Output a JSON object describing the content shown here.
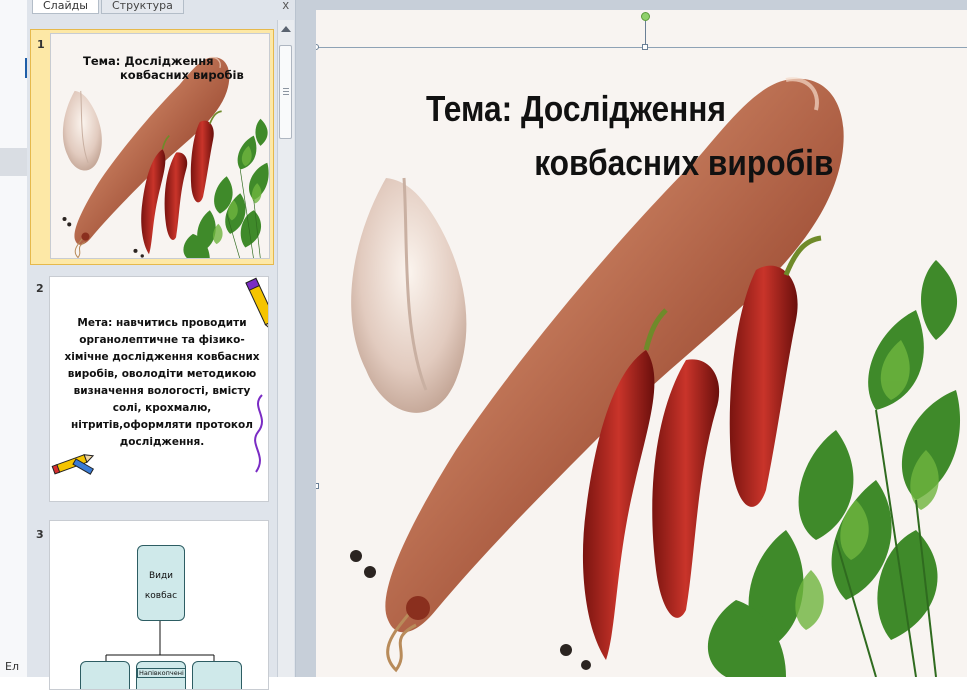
{
  "status_bar": {
    "text": "Ел"
  },
  "panel": {
    "tabs": [
      {
        "label": "Слайды"
      },
      {
        "label": "Структура"
      }
    ],
    "close_label": "x"
  },
  "slides": [
    {
      "number": "1",
      "title_line1": "Тема:  Дослідження",
      "title_line2": "ковбасних виробів"
    },
    {
      "number": "2",
      "goal_text": "Мета: навчитись проводити органолептичне та фізико-хімічне дослідження ковбасних виробів, оволодіти методикою визначення вологості, вмісту солі, крохмалю, нітритів,оформляти протокол дослідження."
    },
    {
      "number": "3",
      "box_main": "Види ковбас",
      "box_mid": "Напівкопчені"
    }
  ],
  "editor": {
    "title_line1": "Тема:  Дослідження",
    "title_line2": "ковбасних виробів"
  },
  "colors": {
    "panel_bg": "#dfe4eb",
    "selected": "#fde8a6",
    "diagram_box": "#cfe9ea"
  }
}
